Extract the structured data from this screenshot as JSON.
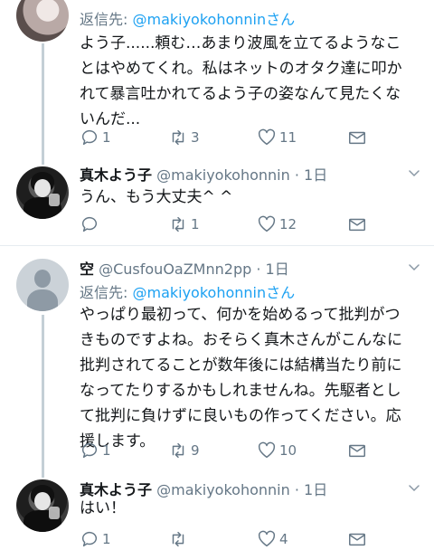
{
  "tweets": [
    {
      "reply_prefix": "返信先: ",
      "reply_handle": "@makiyokohonnin",
      "reply_suffix": "さん",
      "body_lines": [
        "よう子......頼む…あまり波風を立てるようなこ",
        "とはやめてくれ。私はネットのオタク達に叩か",
        "れて暴言吐かれてるよう子の姿なんて見たくな",
        "いんだ..."
      ],
      "replies": "1",
      "retweets": "3",
      "likes": "11"
    },
    {
      "name": "真木よう子",
      "handle": "@makiyokohonnin",
      "time": " · 1日",
      "body_lines": [
        "うん、もう大丈夫^ ^"
      ],
      "replies": "",
      "retweets": "1",
      "likes": "12"
    },
    {
      "name": "空",
      "handle": "@CusfouOaZMnn2pp",
      "time": " · 1日",
      "reply_prefix": "返信先: ",
      "reply_handle": "@makiyokohonnin",
      "reply_suffix": "さん",
      "body_lines": [
        "やっぱり最初って、何かを始めるって批判がつ",
        "きものですよね。おそらく真木さんがこんなに",
        "批判されてることが数年後には結構当たり前に",
        "なってたりするかもしれませんね。先駆者とし",
        "て批判に負けずに良いもの作ってください。応",
        "援します。"
      ],
      "replies": "1",
      "retweets": "9",
      "likes": "10"
    },
    {
      "name": "真木よう子",
      "handle": "@makiyokohonnin",
      "time": " · 1日",
      "body_lines": [
        "はい！"
      ],
      "replies": "1",
      "retweets": "",
      "likes": "4"
    }
  ],
  "icons": {
    "reply": "speech-bubble-icon",
    "retweet": "retweet-arrows-icon",
    "like": "heart-outline-icon",
    "dm": "envelope-icon",
    "menu": "chevron-down-icon"
  },
  "colors": {
    "link": "#1da1f2",
    "secondary": "#657786",
    "thread": "#c4cfd6",
    "divider": "#e6ecf0"
  }
}
